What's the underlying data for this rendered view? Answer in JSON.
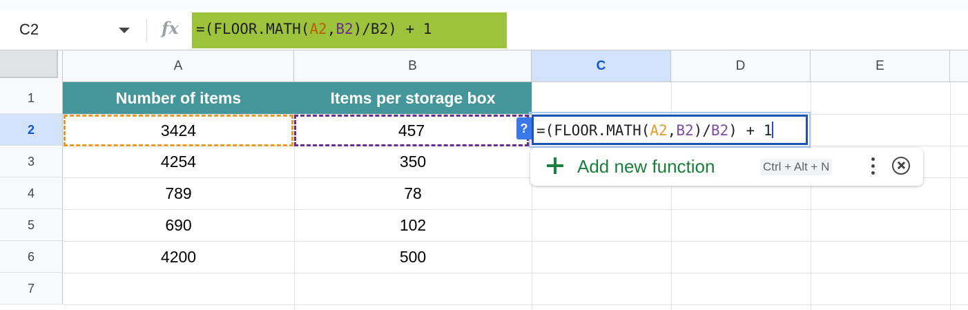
{
  "formula_bar": {
    "name_box": "C2",
    "fx_label": "fx",
    "formula_parts": [
      "=(FLOOR.MATH(",
      "A2",
      ",",
      "B2",
      ")/B2) + 1"
    ]
  },
  "column_headers": [
    "A",
    "B",
    "C",
    "D",
    "E"
  ],
  "selected_column": "C",
  "row_headers": [
    "1",
    "2",
    "3",
    "4",
    "5",
    "6",
    "7"
  ],
  "selected_row": "2",
  "table": {
    "headers": [
      "Number of items",
      "Items per storage box"
    ],
    "rows": [
      [
        "3424",
        "457"
      ],
      [
        "4254",
        "350"
      ],
      [
        "789",
        "78"
      ],
      [
        "690",
        "102"
      ],
      [
        "4200",
        "500"
      ]
    ]
  },
  "cell_editor": {
    "help_badge": "?",
    "formula_parts": [
      "=(FLOOR.MATH(",
      "A2",
      ",",
      "B2",
      ")/",
      "B2",
      ") + 1"
    ]
  },
  "function_popup": {
    "label": "Add new function",
    "shortcut": "Ctrl + Alt + N"
  },
  "colors": {
    "header_fill": "#44969a",
    "formula_highlight": "#9dc23b",
    "ref_a": "#e69a2c",
    "ref_b": "#6a2c91",
    "accent": "#1a53b5"
  }
}
